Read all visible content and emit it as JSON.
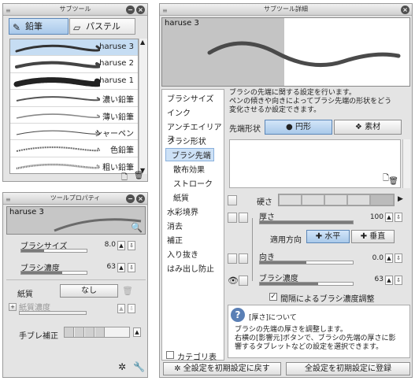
{
  "subtool": {
    "title": "サブツール",
    "tabs": [
      {
        "label": "鉛筆"
      },
      {
        "label": "パステル"
      }
    ],
    "items": [
      {
        "name": "haruse 3"
      },
      {
        "name": "haruse 2"
      },
      {
        "name": "haruse 1"
      },
      {
        "name": "濃い鉛筆"
      },
      {
        "name": "薄い鉛筆"
      },
      {
        "name": "シャーペン"
      },
      {
        "name": "色鉛筆"
      },
      {
        "name": "粗い鉛筆"
      }
    ]
  },
  "toolprop": {
    "title": "ツールプロパティ",
    "preview_name": "haruse 3",
    "brush_size": {
      "label": "ブラシサイズ",
      "value": "8.0",
      "fraction": 0.35
    },
    "brush_density": {
      "label": "ブラシ濃度",
      "value": "63",
      "fraction": 0.63
    },
    "paper": {
      "label": "紙質",
      "value": "なし"
    },
    "paper_density": {
      "label": "紙質濃度"
    },
    "stabilizer": {
      "label": "手ブレ補正"
    }
  },
  "detail": {
    "title": "サブツール詳細",
    "preview_name": "haruse 3",
    "categories": [
      "ブラシサイズ",
      "インク",
      "アンチエイリアス",
      "ブラシ形状",
      "ブラシ先端",
      "散布効果",
      "ストローク",
      "紙質",
      "水彩境界",
      "消去",
      "補正",
      "入り抜き",
      "はみ出し防止"
    ],
    "selected_category": "ブラシ先端",
    "category_display": "カテゴリ表示",
    "description": "ブラシの先端に関する設定を行います。\nペンの傾きや向きによってブラシ先端の形状をどう\n変化させるか設定できます。",
    "tip_shape": {
      "label": "先端形状",
      "options": [
        "円形",
        "素材"
      ]
    },
    "hardness": {
      "label": "硬さ"
    },
    "thickness": {
      "label": "厚さ",
      "value": "100",
      "fraction": 1.0
    },
    "direction_label": "適用方向",
    "direction_options": [
      "水平",
      "垂直"
    ],
    "orientation": {
      "label": "向き",
      "value": "0.0",
      "fraction": 0.5
    },
    "density": {
      "label": "ブラシ濃度",
      "value": "63",
      "fraction": 0.63
    },
    "interval_check": "間隔によるブラシ濃度調整",
    "help": {
      "title": "[厚さ]について",
      "text": "ブラシの先端の厚さを調整します。\n右横の[影響元]ボタンで、ブラシの先端の厚さに影\n響するタブレットなどの設定を選択できます。"
    },
    "reset_all": "全設定を初期設定に戻す",
    "register_all": "全設定を初期設定に登録"
  }
}
